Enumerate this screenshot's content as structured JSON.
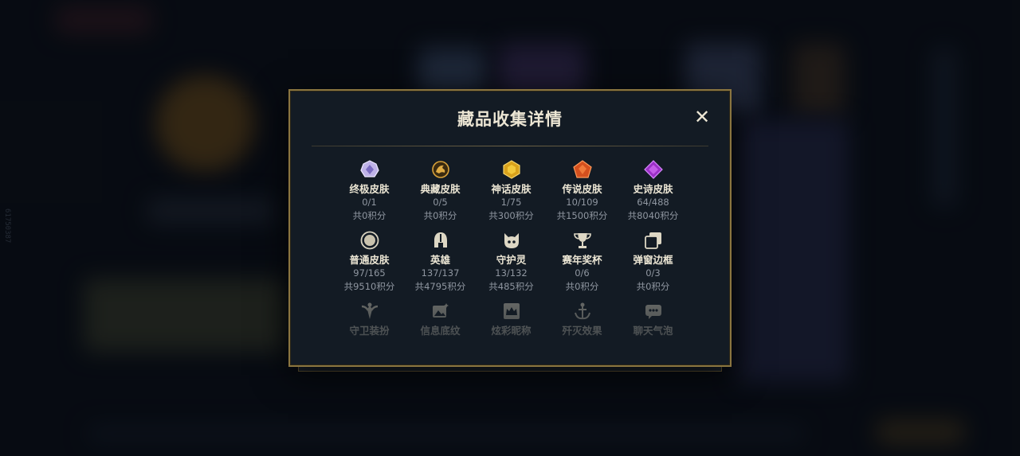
{
  "app": {
    "build_id": "61750387"
  },
  "modal": {
    "title": "藏品收集详情",
    "close_label": "✕",
    "categories": [
      {
        "name": "终极皮肤",
        "count": "0/1",
        "points": "共0积分",
        "icon": "ultimate-skin-gem-icon"
      },
      {
        "name": "典藏皮肤",
        "count": "0/5",
        "points": "共0积分",
        "icon": "collector-dragon-icon"
      },
      {
        "name": "神话皮肤",
        "count": "1/75",
        "points": "共300积分",
        "icon": "mythic-gem-icon"
      },
      {
        "name": "传说皮肤",
        "count": "10/109",
        "points": "共1500积分",
        "icon": "legendary-gem-icon"
      },
      {
        "name": "史诗皮肤",
        "count": "64/488",
        "points": "共8040积分",
        "icon": "epic-gem-icon"
      },
      {
        "name": "普通皮肤",
        "count": "97/165",
        "points": "共9510积分",
        "icon": "standard-skin-circle-icon"
      },
      {
        "name": "英雄",
        "count": "137/137",
        "points": "共4795积分",
        "icon": "champion-helmet-icon"
      },
      {
        "name": "守护灵",
        "count": "13/132",
        "points": "共485积分",
        "icon": "guardian-spirit-icon"
      },
      {
        "name": "赛年奖杯",
        "count": "0/6",
        "points": "共0积分",
        "icon": "season-trophy-icon"
      },
      {
        "name": "弹窗边框",
        "count": "0/3",
        "points": "共0积分",
        "icon": "popup-frame-icon"
      },
      {
        "name": "守卫装扮",
        "icon": "ward-skin-icon"
      },
      {
        "name": "信息底纹",
        "icon": "profile-banner-icon"
      },
      {
        "name": "炫彩昵称",
        "icon": "colorful-nickname-icon"
      },
      {
        "name": "歼灭效果",
        "icon": "elimination-effect-icon"
      },
      {
        "name": "聊天气泡",
        "icon": "chat-bubble-icon"
      }
    ]
  },
  "colors": {
    "modal_border": "#8a7540",
    "modal_bg": "#131b24",
    "title": "#ece6d4",
    "secondary_text": "#8f96a0"
  }
}
